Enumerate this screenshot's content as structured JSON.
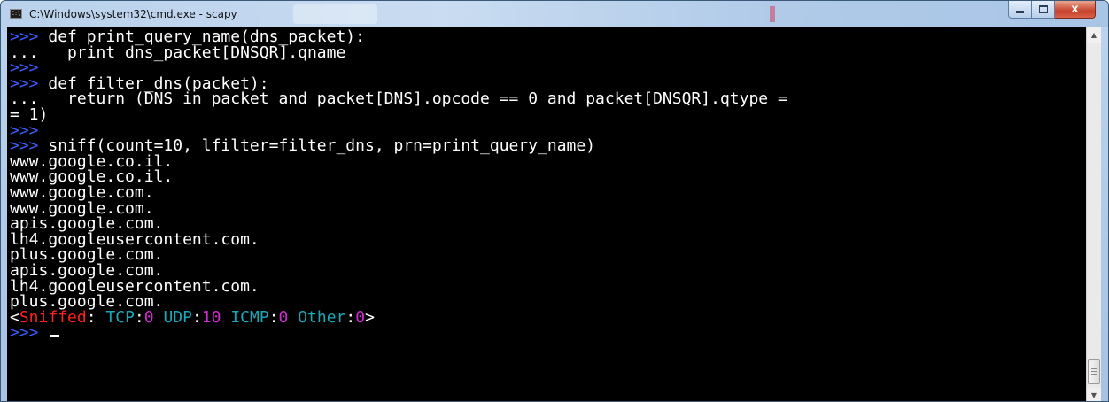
{
  "window": {
    "title": "C:\\Windows\\system32\\cmd.exe - scapy",
    "icon": "cmd-icon",
    "close_glyph": "x"
  },
  "console": {
    "lines": [
      [
        {
          "t": ">>> ",
          "c": "prompt"
        },
        {
          "t": "def print_query_name(dns_packet):"
        }
      ],
      [
        {
          "t": "...   "
        },
        {
          "t": "print dns_packet[DNSQR].qname"
        }
      ],
      [
        {
          "t": ">>>",
          "c": "prompt"
        }
      ],
      [
        {
          "t": ">>> ",
          "c": "prompt"
        },
        {
          "t": "def filter_dns(packet):"
        }
      ],
      [
        {
          "t": "...   "
        },
        {
          "t": "return (DNS in packet and packet[DNS].opcode == 0 and packet[DNSQR].qtype ="
        }
      ],
      [
        {
          "t": "= 1)"
        }
      ],
      [
        {
          "t": ">>>",
          "c": "prompt"
        }
      ],
      [
        {
          "t": ">>> ",
          "c": "prompt"
        },
        {
          "t": "sniff(count=10, lfilter=filter_dns, prn=print_query_name)"
        }
      ],
      [
        {
          "t": "www.google.co.il."
        }
      ],
      [
        {
          "t": "www.google.co.il."
        }
      ],
      [
        {
          "t": "www.google.com."
        }
      ],
      [
        {
          "t": "www.google.com."
        }
      ],
      [
        {
          "t": "apis.google.com."
        }
      ],
      [
        {
          "t": "lh4.googleusercontent.com."
        }
      ],
      [
        {
          "t": "plus.google.com."
        }
      ],
      [
        {
          "t": "apis.google.com."
        }
      ],
      [
        {
          "t": "lh4.googleusercontent.com."
        }
      ],
      [
        {
          "t": "plus.google.com."
        }
      ],
      [
        {
          "t": "<"
        },
        {
          "t": "Sniffed",
          "c": "c-red"
        },
        {
          "t": ": "
        },
        {
          "t": "TCP",
          "c": "c-cyan"
        },
        {
          "t": ":"
        },
        {
          "t": "0",
          "c": "c-mag"
        },
        {
          "t": " "
        },
        {
          "t": "UDP",
          "c": "c-cyan"
        },
        {
          "t": ":"
        },
        {
          "t": "10",
          "c": "c-mag"
        },
        {
          "t": " "
        },
        {
          "t": "ICMP",
          "c": "c-cyan"
        },
        {
          "t": ":"
        },
        {
          "t": "0",
          "c": "c-mag"
        },
        {
          "t": " "
        },
        {
          "t": "Other",
          "c": "c-cyan"
        },
        {
          "t": ":"
        },
        {
          "t": "0",
          "c": "c-mag"
        },
        {
          "t": ">"
        }
      ],
      [
        {
          "t": ">>> ",
          "c": "prompt"
        }
      ]
    ]
  },
  "colors": {
    "prompt": "#3c5cff",
    "sniffed": "#ff2020",
    "protocol": "#19a8b8",
    "count": "#d42ad4",
    "console_bg": "#000000",
    "console_fg": "#ffffff"
  },
  "scrollbar": {
    "up_icon": "scroll-up-arrow-icon",
    "down_icon": "scroll-down-arrow-icon"
  }
}
